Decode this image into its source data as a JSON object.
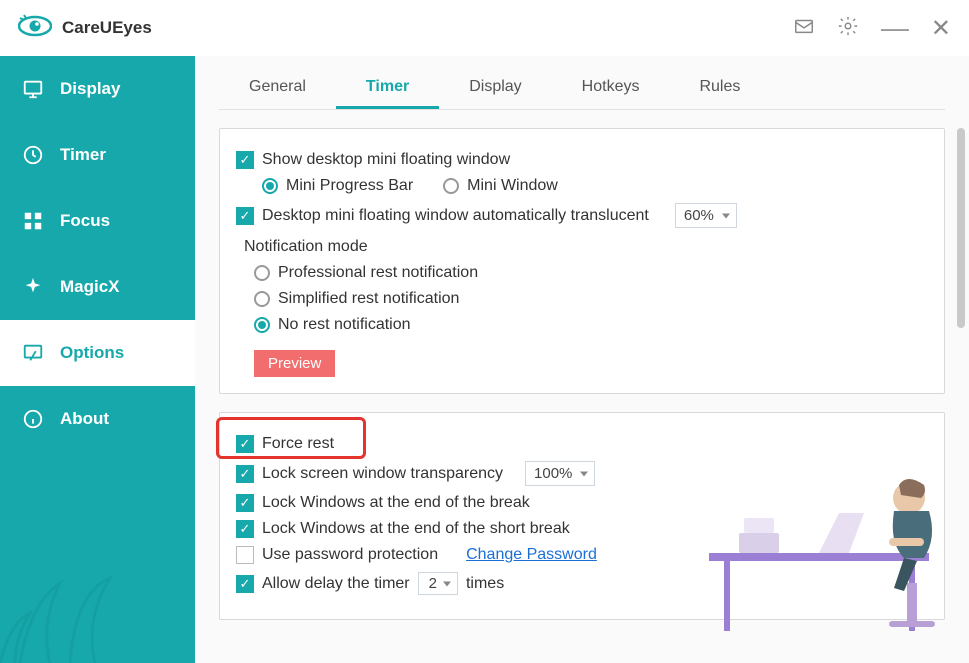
{
  "app": {
    "name": "CareUEyes"
  },
  "sidebar": {
    "items": [
      {
        "label": "Display"
      },
      {
        "label": "Timer"
      },
      {
        "label": "Focus"
      },
      {
        "label": "MagicX"
      },
      {
        "label": "Options"
      },
      {
        "label": "About"
      }
    ]
  },
  "tabs": {
    "items": [
      {
        "label": "General"
      },
      {
        "label": "Timer"
      },
      {
        "label": "Display"
      },
      {
        "label": "Hotkeys"
      },
      {
        "label": "Rules"
      }
    ]
  },
  "panel1": {
    "show_floating": "Show desktop mini floating window",
    "mini_progress": "Mini Progress Bar",
    "mini_window": "Mini Window",
    "auto_translucent": "Desktop mini floating window automatically translucent",
    "translucent_value": "60%",
    "notif_mode": "Notification mode",
    "notif_pro": "Professional rest notification",
    "notif_simple": "Simplified rest notification",
    "notif_none": "No rest notification",
    "preview": "Preview"
  },
  "panel2": {
    "force_rest": "Force rest",
    "lock_transparency": "Lock screen window transparency",
    "transparency_value": "100%",
    "lock_end_break": "Lock Windows at the end of the break",
    "lock_end_short": "Lock Windows at the end of the short break",
    "use_password": "Use password protection",
    "change_password": "Change Password",
    "allow_delay_pre": "Allow delay the timer",
    "allow_delay_value": "2",
    "allow_delay_post": "times"
  }
}
